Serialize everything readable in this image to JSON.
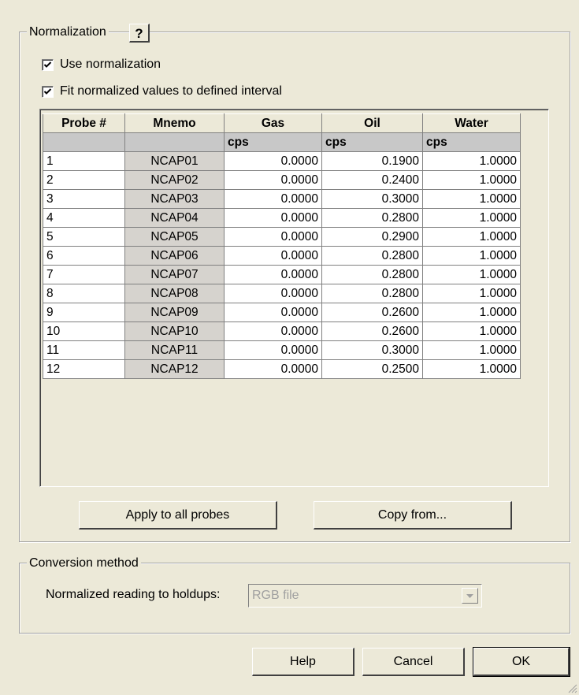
{
  "normalization": {
    "title": "Normalization",
    "help_label": "?",
    "use_normalization": {
      "label": "Use normalization",
      "checked": true
    },
    "fit_interval": {
      "label": "Fit normalized values to defined interval",
      "checked": true
    },
    "table": {
      "headers": [
        "Probe #",
        "Mnemo",
        "Gas",
        "Oil",
        "Water"
      ],
      "units": [
        "",
        "",
        "cps",
        "cps",
        "cps"
      ],
      "rows": [
        [
          "1",
          "NCAP01",
          "0.0000",
          "0.1900",
          "1.0000"
        ],
        [
          "2",
          "NCAP02",
          "0.0000",
          "0.2400",
          "1.0000"
        ],
        [
          "3",
          "NCAP03",
          "0.0000",
          "0.3000",
          "1.0000"
        ],
        [
          "4",
          "NCAP04",
          "0.0000",
          "0.2800",
          "1.0000"
        ],
        [
          "5",
          "NCAP05",
          "0.0000",
          "0.2900",
          "1.0000"
        ],
        [
          "6",
          "NCAP06",
          "0.0000",
          "0.2800",
          "1.0000"
        ],
        [
          "7",
          "NCAP07",
          "0.0000",
          "0.2800",
          "1.0000"
        ],
        [
          "8",
          "NCAP08",
          "0.0000",
          "0.2800",
          "1.0000"
        ],
        [
          "9",
          "NCAP09",
          "0.0000",
          "0.2600",
          "1.0000"
        ],
        [
          "10",
          "NCAP10",
          "0.0000",
          "0.2600",
          "1.0000"
        ],
        [
          "11",
          "NCAP11",
          "0.0000",
          "0.3000",
          "1.0000"
        ],
        [
          "12",
          "NCAP12",
          "0.0000",
          "0.2500",
          "1.0000"
        ]
      ]
    },
    "apply_all_label": "Apply to all probes",
    "copy_from_label": "Copy from..."
  },
  "conversion": {
    "title": "Conversion method",
    "holdups_label": "Normalized reading to holdups:",
    "holdups_value": "RGB file"
  },
  "footer": {
    "help_label": "Help",
    "cancel_label": "Cancel",
    "ok_label": "OK"
  }
}
